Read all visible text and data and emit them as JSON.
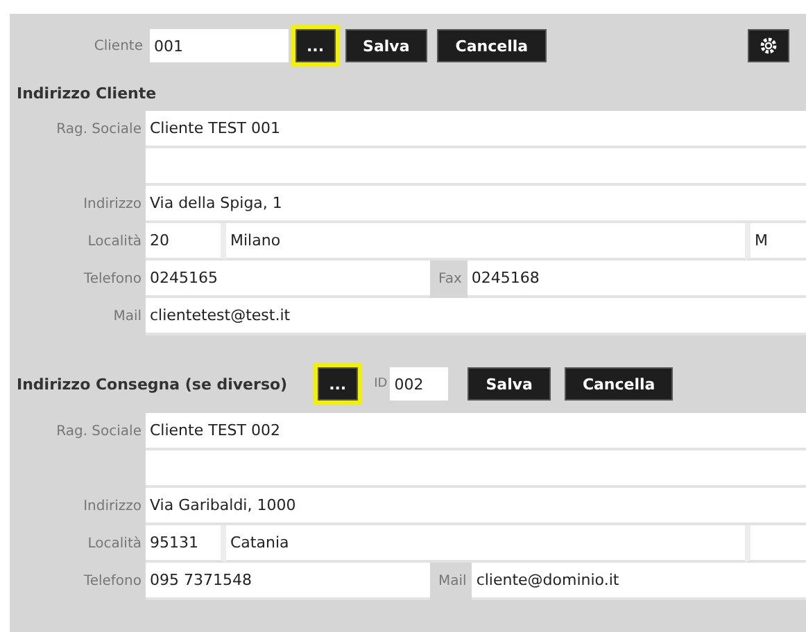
{
  "toolbar": {
    "client_label": "Cliente",
    "client_value": "001",
    "lookup_button": {
      "label": "...",
      "highlighted": true
    },
    "buttons": [
      "Salva",
      "Cancella"
    ]
  },
  "sections": [
    {
      "heading": "Indirizzo Cliente",
      "lines": [
        {
          "label": "Rag. Sociale",
          "fields": [
            {
              "kind": "fill",
              "value": "Cliente TEST 001"
            }
          ]
        },
        {
          "fields": [
            {
              "kind": "fill"
            }
          ]
        },
        {
          "label": "Indirizzo",
          "fields": [
            {
              "kind": "fill",
              "value": "Via della Spiga, 1"
            }
          ]
        },
        {
          "label": "Località",
          "fields": [
            {
              "kind": "short",
              "value": "20"
            },
            {
              "kind": "fill",
              "value": "Milano"
            },
            {
              "kind": "tiny",
              "value": "M"
            }
          ]
        },
        {
          "label": "Telefono",
          "fields": [
            {
              "kind": "half",
              "value": "0245165"
            },
            {
              "kind": "fill",
              "label": "Fax",
              "value": "0245168"
            }
          ]
        },
        {
          "label": "Mail",
          "fields": [
            {
              "kind": "fill",
              "value": "clientetest@test.it"
            }
          ]
        }
      ]
    },
    {
      "heading": "Indirizzo Consegna (se diverso)",
      "lookup_button": {
        "label": "...",
        "highlighted": true
      },
      "id_label": "ID",
      "id_value": "002",
      "buttons": [
        "Salva",
        "Cancella"
      ],
      "lines": [
        {
          "label": "Rag. Sociale",
          "fields": [
            {
              "kind": "fill",
              "value": "Cliente TEST 002"
            }
          ]
        },
        {
          "fields": [
            {
              "kind": "fill"
            }
          ]
        },
        {
          "label": "Indirizzo",
          "fields": [
            {
              "kind": "fill",
              "value": "Via Garibaldi, 1000"
            }
          ]
        },
        {
          "label": "Località",
          "fields": [
            {
              "kind": "short",
              "value": "95131"
            },
            {
              "kind": "fill",
              "value": "Catania"
            },
            {
              "kind": "tiny"
            }
          ]
        },
        {
          "label": "Telefono",
          "fields": [
            {
              "kind": "half",
              "value": "095 7371548"
            },
            {
              "kind": "fill",
              "label": "Mail",
              "value": "cliente@dominio.it"
            }
          ]
        }
      ]
    }
  ]
}
